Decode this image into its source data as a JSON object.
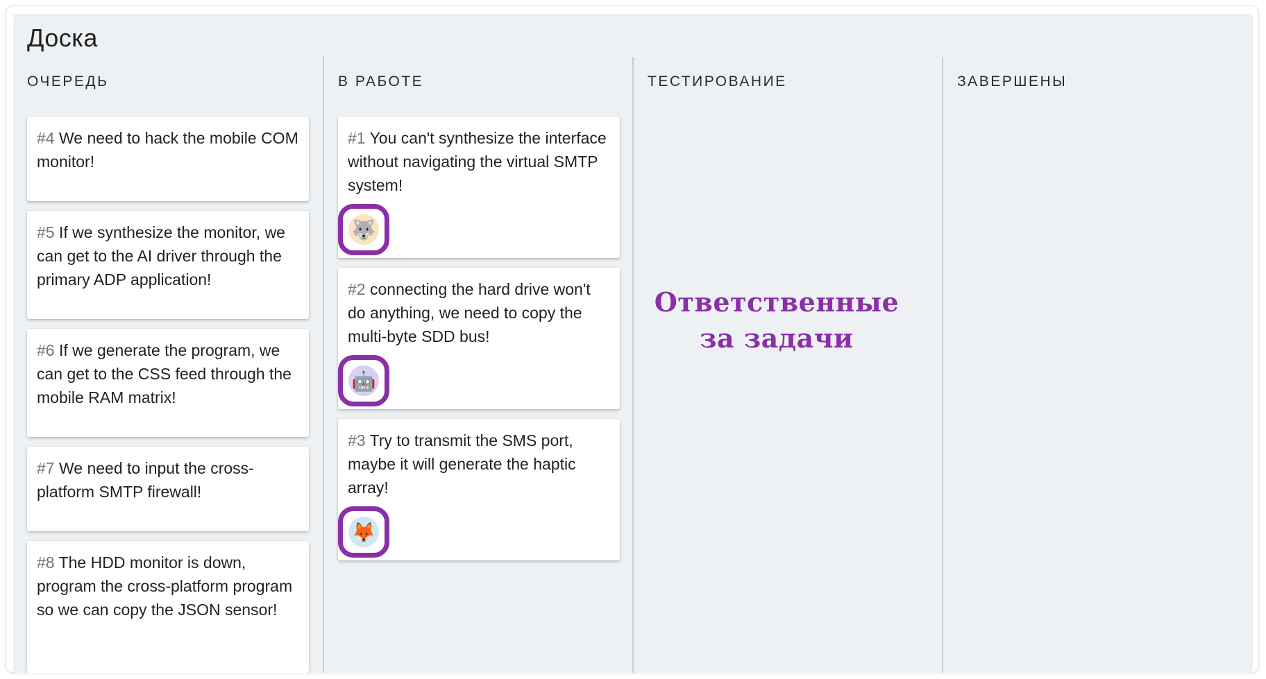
{
  "board": {
    "title": "Доска"
  },
  "columns": [
    {
      "header": "ОЧЕРЕДЬ",
      "cards": [
        {
          "id": "#4",
          "text": "We need to hack the mobile COM monitor!"
        },
        {
          "id": "#5",
          "text": "If we synthesize the monitor, we can get to the AI driver through the primary ADP application!"
        },
        {
          "id": "#6",
          "text": "If we generate the program, we can get to the CSS feed through the mobile RAM matrix!"
        },
        {
          "id": "#7",
          "text": "We need to input the cross-platform SMTP firewall!"
        },
        {
          "id": "#8",
          "text": "The HDD monitor is down, program the cross-platform program so we can copy the JSON sensor!"
        }
      ]
    },
    {
      "header": "В РАБОТЕ",
      "cards": [
        {
          "id": "#1",
          "text": "You can't synthesize the interface without navigating the virtual SMTP system!",
          "avatar": "🐺",
          "avatar_icon": "wolf-avatar-icon"
        },
        {
          "id": "#2",
          "text": "connecting the hard drive won't do anything, we need to copy the multi-byte SDD bus!",
          "avatar": "🤖",
          "avatar_icon": "robot-avatar-icon"
        },
        {
          "id": "#3",
          "text": "Try to transmit the SMS port, maybe it will generate the haptic array!",
          "avatar": "🦊",
          "avatar_icon": "fox-avatar-icon"
        }
      ]
    },
    {
      "header": "ТЕСТИРОВАНИЕ",
      "cards": []
    },
    {
      "header": "ЗАВЕРШЕНЫ",
      "cards": []
    }
  ],
  "annotation": {
    "line1": "Ответственные",
    "line2": "за задачи"
  },
  "colors": {
    "board_bg": "#eef1f3",
    "card_bg": "#ffffff",
    "highlight": "#8a2fa8",
    "id_text": "#757575"
  }
}
